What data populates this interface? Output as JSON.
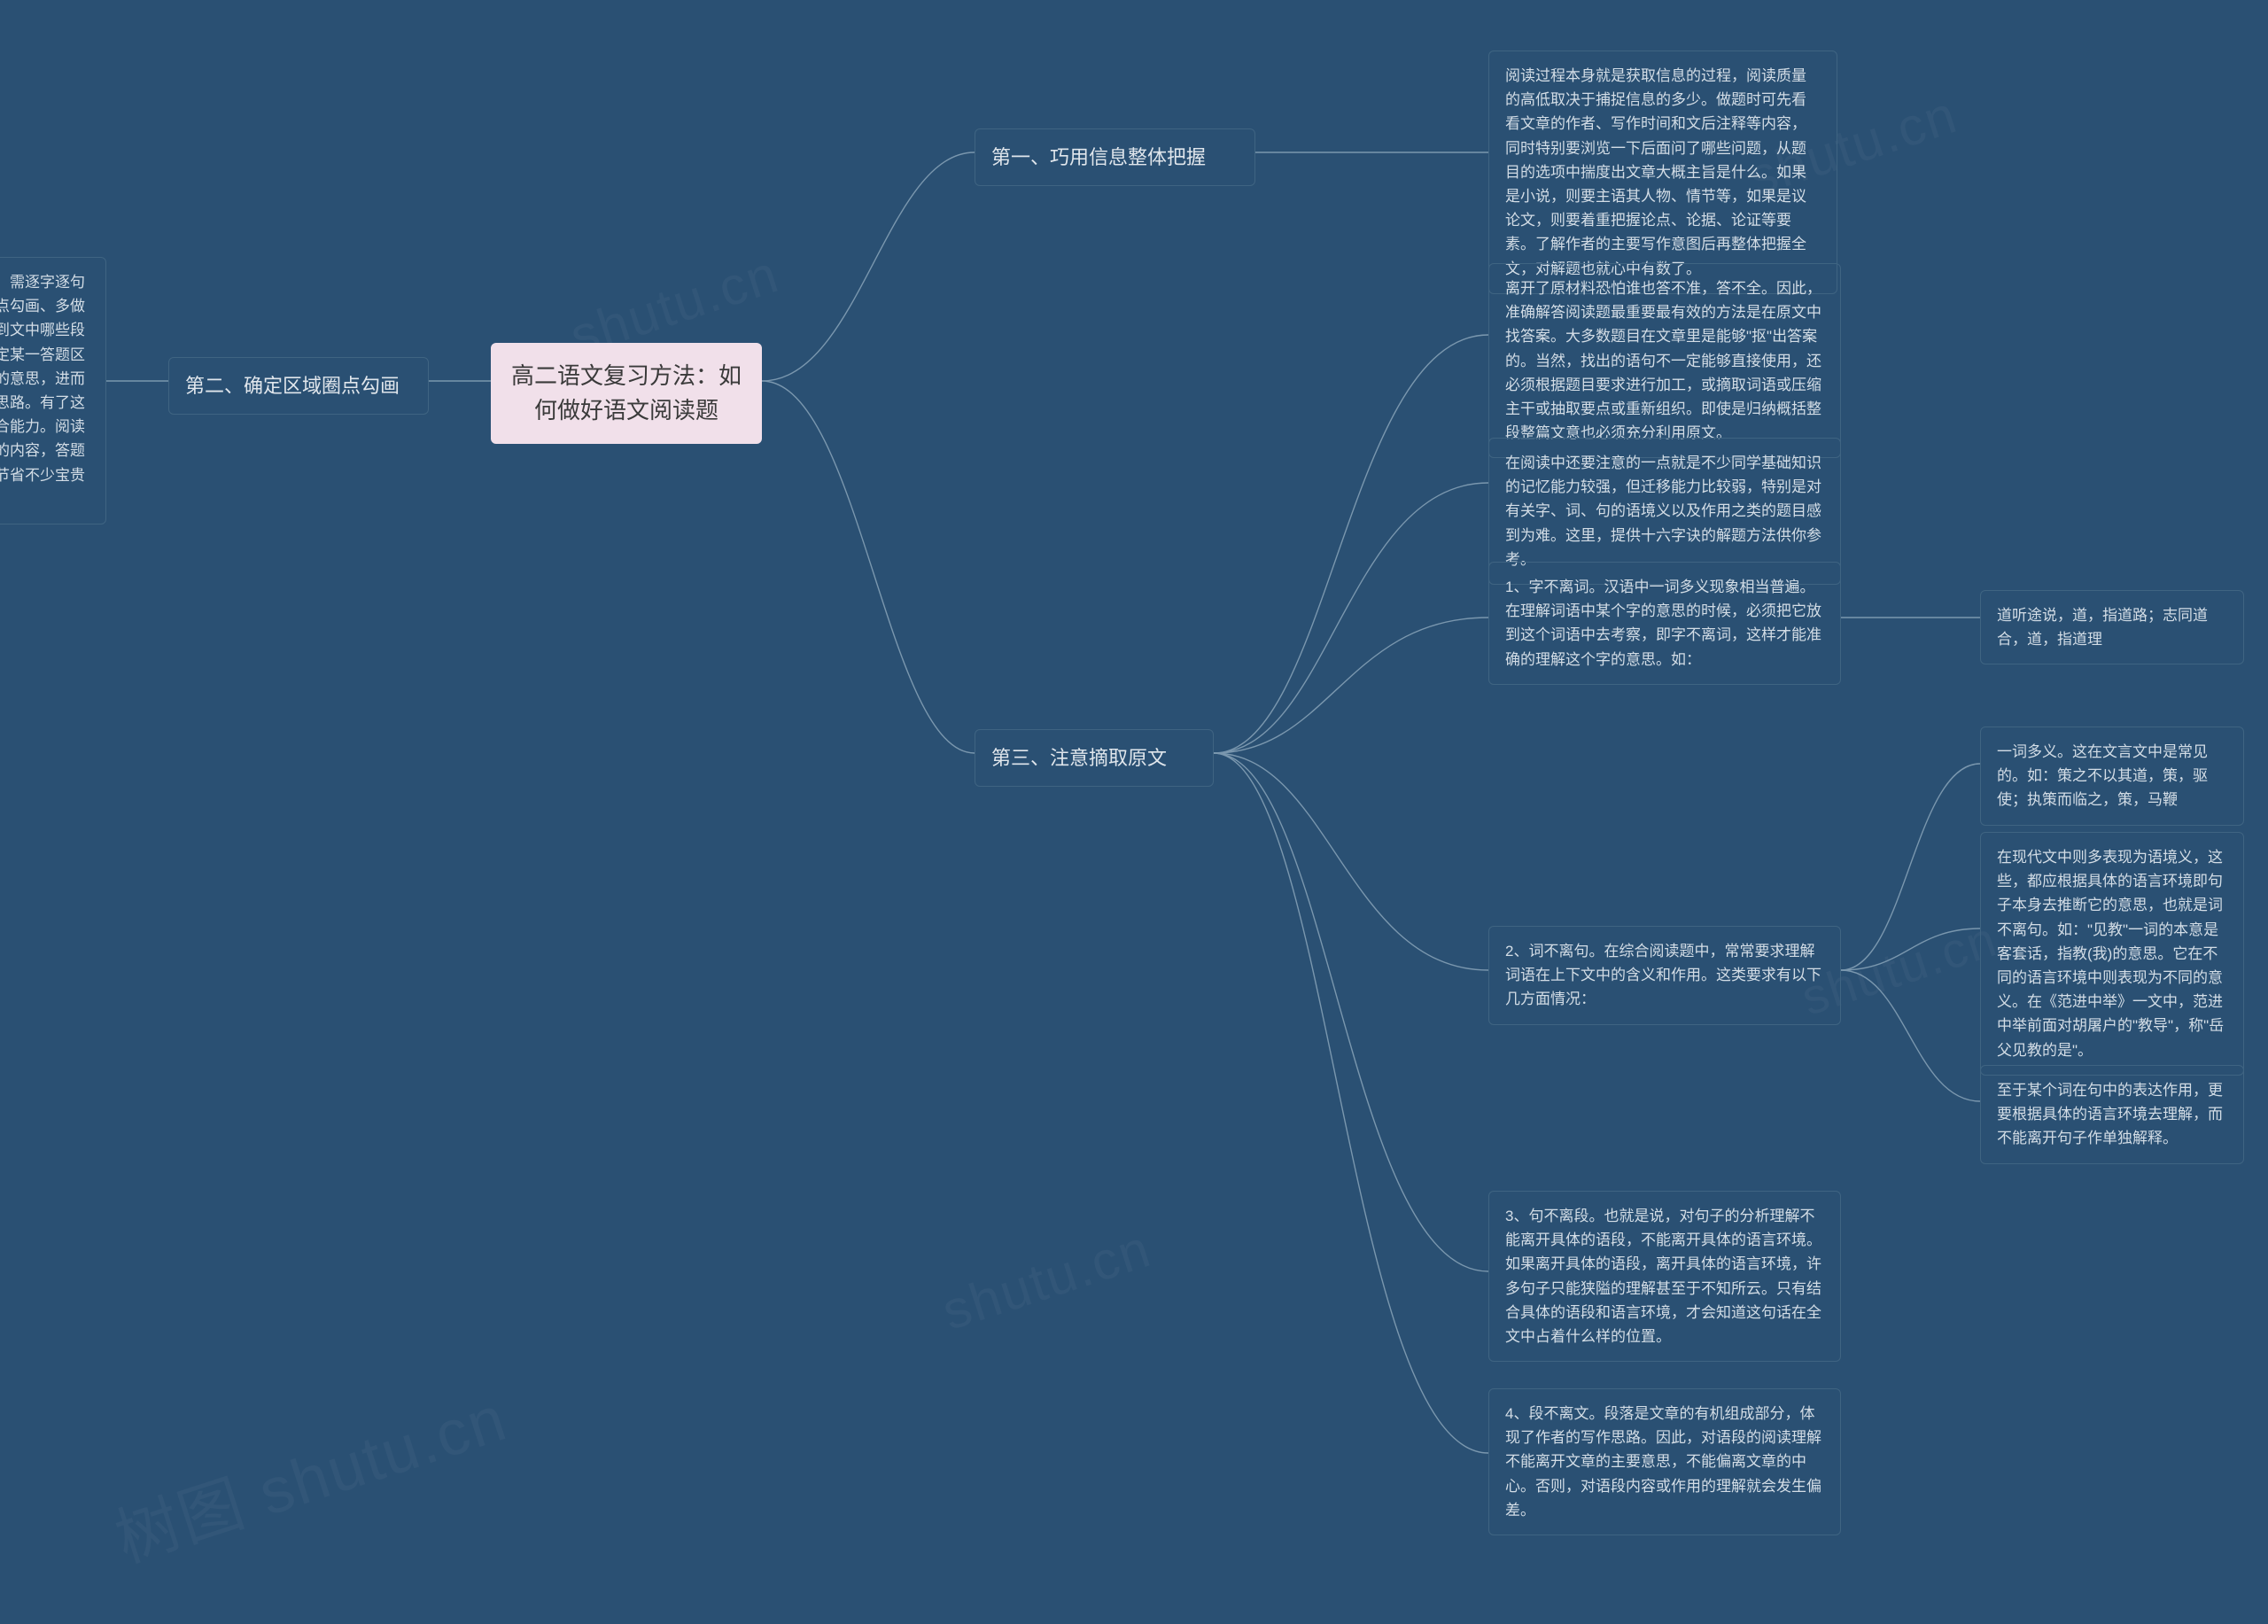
{
  "root": {
    "title": "高二语文复习方法：如何做好语文阅读题"
  },
  "branch1": {
    "title": "第一、巧用信息整体把握",
    "detail": "阅读过程本身就是获取信息的过程，阅读质量的高低取决于捕捉信息的多少。做题时可先看看文章的作者、写作时间和文后注释等内容，同时特别要浏览一下后面问了哪些问题，从题目的选项中揣度出文章大概主旨是什么。如果是小说，则要主语其人物、情节等，如果是议论文，则要着重把握论点、论据、论证等要素。了解作者的主要写作意图后再整体把握全文，对解题也就心中有数了。"
  },
  "branch2": {
    "title": "第二、确定区域圈点勾画",
    "detail": "阅读大段文章主要用精读的方法，需逐字逐句推敲揣摩，故平时练习要养成圈点勾画、多做记号的习惯，可以先看题目涉及到文中哪些段落或区域，和哪些语句有关。确定某一答题区域后，再仔细弄懂这一段每一句的意思，进而理清段落之间的关系，了解行文思路。有了这一习惯就有可能形成较强分析综合能力。阅读时反复琢磨题干，圈画与之相关的内容，答题时就不需要再从头至尾搜寻，可节省不少宝贵时间。"
  },
  "branch3": {
    "title": "第三、注意摘取原文",
    "children": {
      "c1": "离开了原材料恐怕谁也答不准，答不全。因此，准确解答阅读题最重要最有效的方法是在原文中找答案。大多数题目在文章里是能够\"抠\"出答案的。当然，找出的语句不一定能够直接使用，还必须根据题目要求进行加工，或摘取词语或压缩主干或抽取要点或重新组织。即使是归纳概括整段整篇文意也必须充分利用原文。",
      "c2": "在阅读中还要注意的一点就是不少同学基础知识的记忆能力较强，但迁移能力比较弱，特别是对有关字、词、句的语境义以及作用之类的题目感到为难。这里，提供十六字诀的解题方法供你参考。",
      "c3": {
        "text": "1、字不离词。汉语中一词多义现象相当普遍。在理解词语中某个字的意思的时候，必须把它放到这个词语中去考察，即字不离词，这样才能准确的理解这个字的意思。如：",
        "sub": "道听途说，道，指道路；志同道合，道，指道理"
      },
      "c4": {
        "text": "2、词不离句。在综合阅读题中，常常要求理解词语在上下文中的含义和作用。这类要求有以下几方面情况：",
        "subs": {
          "s1": "一词多义。这在文言文中是常见的。如：策之不以其道，策，驱使；执策而临之，策，马鞭",
          "s2": "在现代文中则多表现为语境义，这些，都应根据具体的语言环境即句子本身去推断它的意思，也就是词不离句。如：\"见教\"一词的本意是客套话，指教(我)的意思。它在不同的语言环境中则表现为不同的意义。在《范进中举》一文中，范进中举前面对胡屠户的\"教导\"，称\"岳父见教的是\"。",
          "s3": "至于某个词在句中的表达作用，更要根据具体的语言环境去理解，而不能离开句子作单独解释。"
        }
      },
      "c5": "3、句不离段。也就是说，对句子的分析理解不能离开具体的语段，不能离开具体的语言环境。如果离开具体的语段，离开具体的语言环境，许多句子只能狭隘的理解甚至于不知所云。只有结合具体的语段和语言环境，才会知道这句话在全文中占着什么样的位置。",
      "c6": "4、段不离文。段落是文章的有机组成部分，体现了作者的写作思路。因此，对语段的阅读理解不能离开文章的主要意思，不能偏离文章的中心。否则，对语段内容或作用的理解就会发生偏差。"
    }
  },
  "watermarks": [
    "shutu.cn",
    "shutu.cn",
    "shutu.cn",
    "树图 shutu.cn",
    "shutu.cn"
  ]
}
